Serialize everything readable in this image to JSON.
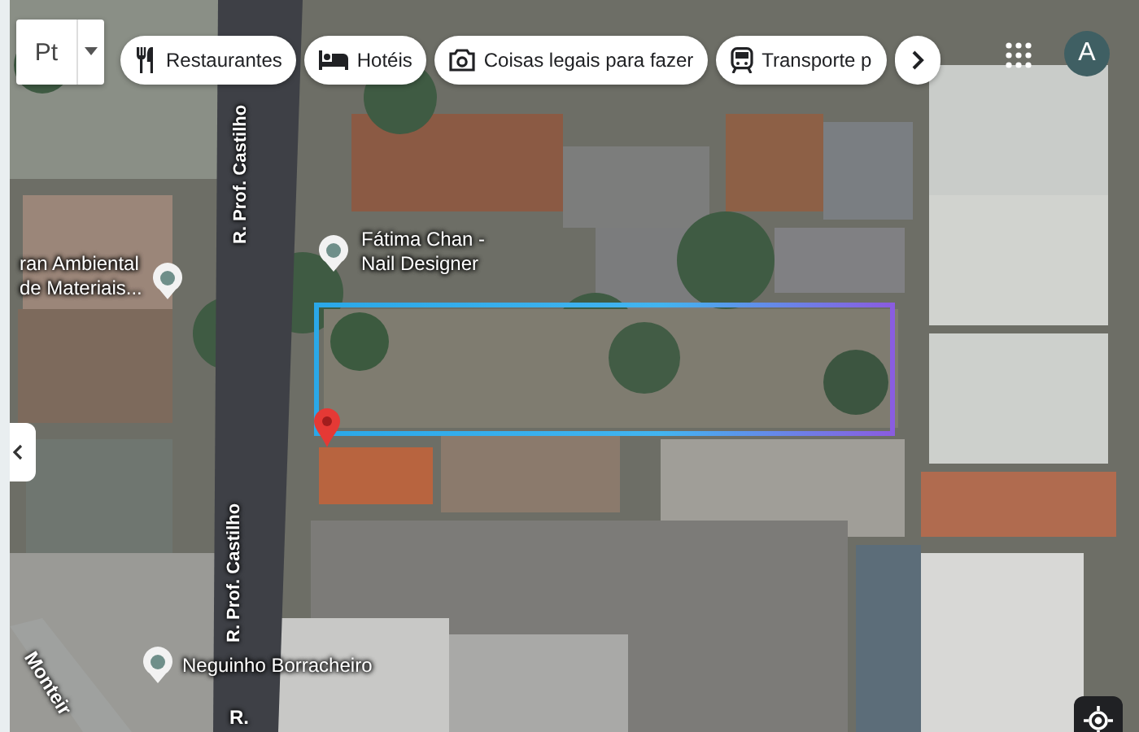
{
  "map_type_button": {
    "label": "Pt"
  },
  "chips": [
    {
      "kind": "restaurant",
      "label": "Restaurantes"
    },
    {
      "kind": "hotel",
      "label": "Hotéis"
    },
    {
      "kind": "camera",
      "label": "Coisas legais para fazer"
    },
    {
      "kind": "transit",
      "label": "Transporte p"
    }
  ],
  "account": {
    "initial": "A"
  },
  "streets": [
    {
      "label": "R. Prof. Castilho"
    },
    {
      "label": "R. Prof. Castilho"
    },
    {
      "label": "Monteir"
    },
    {
      "label": "R."
    }
  ],
  "places": [
    {
      "label": "Fátima Chan -\nNail Designer"
    },
    {
      "label": "ran Ambiental\nde Materiais..."
    },
    {
      "label": "Neguinho Borracheiro"
    }
  ]
}
